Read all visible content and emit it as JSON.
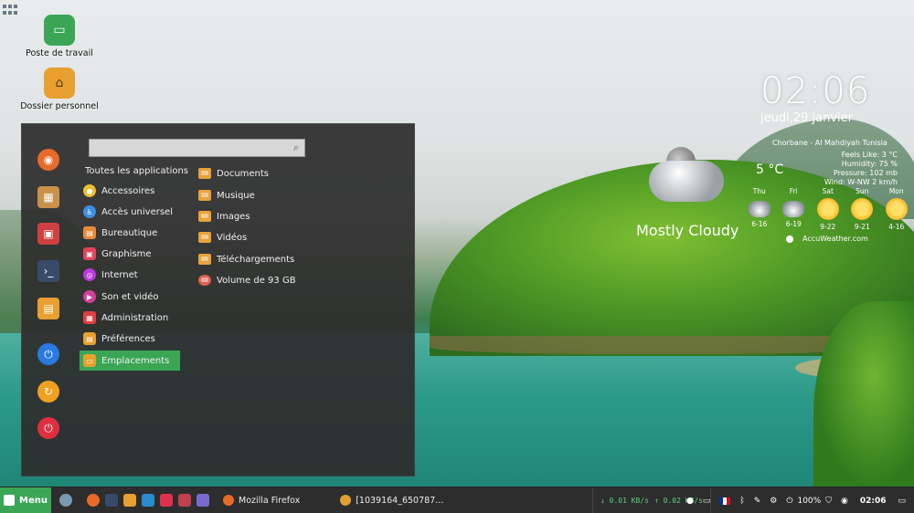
{
  "desktop": {
    "icons": [
      {
        "label": "Poste de travail"
      },
      {
        "label": "Dossier personnel"
      }
    ]
  },
  "menu": {
    "search_value": "",
    "categories_title": "Toutes les applications",
    "categories": [
      {
        "label": "Accessoires",
        "color": "#f0c02a"
      },
      {
        "label": "Accès universel",
        "color": "#3d8fe0"
      },
      {
        "label": "Bureautique",
        "color": "#e88a3a"
      },
      {
        "label": "Graphisme",
        "color": "#e0455a"
      },
      {
        "label": "Internet",
        "color": "#b93ad8"
      },
      {
        "label": "Son et vidéo",
        "color": "#d0409a"
      },
      {
        "label": "Administration",
        "color": "#e04040"
      },
      {
        "label": "Préférences",
        "color": "#e8a030"
      },
      {
        "label": "Emplacements",
        "color": "#e8a030"
      }
    ],
    "active_category": "Emplacements",
    "places": [
      {
        "label": "Documents"
      },
      {
        "label": "Musique"
      },
      {
        "label": "Images"
      },
      {
        "label": "Vidéos"
      },
      {
        "label": "Téléchargements"
      },
      {
        "label": "Volume de 93 GB"
      }
    ]
  },
  "clock": {
    "time": "02:06",
    "date": "jeudi,29 janvier"
  },
  "weather": {
    "location": "Chorbane - Al Mahdiyah Tunisia",
    "temperature": "5 °C",
    "feels_like": "Feels Like: 3 °C",
    "humidity": "Humidity: 75 %",
    "pressure": "Pressure: 102 mb",
    "wind": "Wind: W-NW 2 km/h",
    "condition": "Mostly Cloudy",
    "forecast": [
      {
        "day": "Thu",
        "range": "6-16",
        "icon": "cloudy"
      },
      {
        "day": "Fri",
        "range": "6-19",
        "icon": "cloudy"
      },
      {
        "day": "Sat",
        "range": "9-22",
        "icon": "sun"
      },
      {
        "day": "Sun",
        "range": "9-21",
        "icon": "sun"
      },
      {
        "day": "Mon",
        "range": "4-16",
        "icon": "sun"
      }
    ],
    "provider": "AccuWeather.com"
  },
  "taskbar": {
    "menu_label": "Menu",
    "windows": [
      {
        "label": "Mozilla Firefox"
      },
      {
        "label": "[1039164_650787..."
      }
    ],
    "net_down": "↓ 0.01 KB/s",
    "net_up": "↑ 0.02 KB/s",
    "battery": "100%",
    "time": "02:06"
  },
  "colors": {
    "accent": "#3aa655",
    "menu_bg": "#2d2d2d",
    "net_text": "#5fd07a"
  }
}
